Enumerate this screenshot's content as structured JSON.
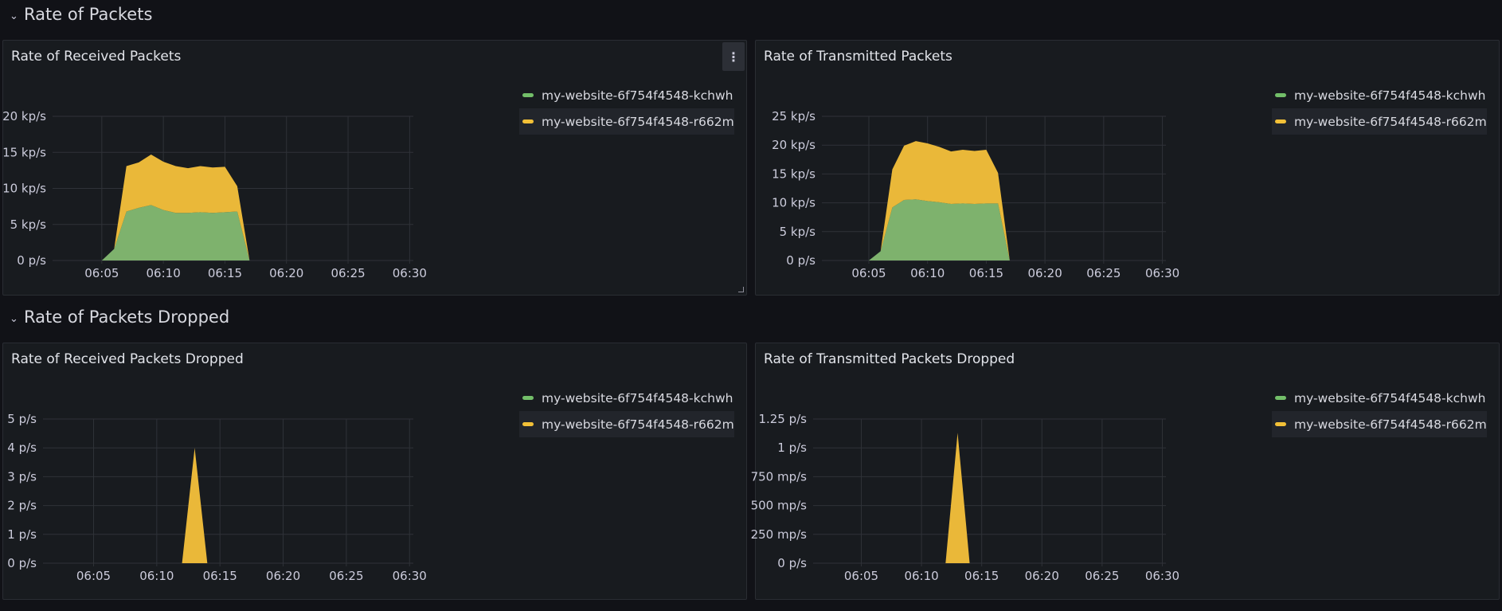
{
  "rows": [
    {
      "title": "Rate of Packets"
    },
    {
      "title": "Rate of Packets Dropped"
    }
  ],
  "colors": {
    "green": "#7eb26d",
    "yellow": "#eab839",
    "grid": "#2f3238"
  },
  "legend": [
    {
      "label": "my-website-6f754f4548-kchwh",
      "color": "#73bf69"
    },
    {
      "label": "my-website-6f754f4548-r662m",
      "color": "#f2c037"
    }
  ],
  "menu_icon": "kebab-vertical-icon",
  "panels": [
    {
      "title": "Rate of Received Packets",
      "chart_data": {
        "type": "area",
        "stacked": true,
        "x_ticks": [
          "06:05",
          "06:10",
          "06:15",
          "06:20",
          "06:25",
          "06:30"
        ],
        "x_tick_minutes": [
          5,
          10,
          15,
          20,
          25,
          30
        ],
        "xlim": [
          1,
          30.3
        ],
        "y_ticks": [
          "0 p/s",
          "5 kp/s",
          "10 kp/s",
          "15 kp/s",
          "20 kp/s"
        ],
        "ylim": [
          0,
          20000
        ],
        "x": [
          5,
          6,
          7,
          8,
          9,
          10,
          11,
          12,
          13,
          14,
          15,
          16,
          17
        ],
        "series": [
          {
            "name": "my-website-6f754f4548-kchwh",
            "values": [
              0,
              1600,
              6800,
              7300,
              7700,
              7000,
              6600,
              6600,
              6700,
              6600,
              6700,
              6800,
              0
            ]
          },
          {
            "name": "my-website-6f754f4548-r662m",
            "values": [
              0,
              0,
              6300,
              6300,
              7000,
              6700,
              6500,
              6200,
              6400,
              6300,
              6300,
              3500,
              0
            ]
          }
        ],
        "grid": true,
        "legend_position": "right"
      }
    },
    {
      "title": "Rate of Transmitted Packets",
      "chart_data": {
        "type": "area",
        "stacked": true,
        "x_ticks": [
          "06:05",
          "06:10",
          "06:15",
          "06:20",
          "06:25",
          "06:30"
        ],
        "x_tick_minutes": [
          5,
          10,
          15,
          20,
          25,
          30
        ],
        "xlim": [
          1,
          30.3
        ],
        "y_ticks": [
          "0 p/s",
          "5 kp/s",
          "10 kp/s",
          "15 kp/s",
          "20 kp/s",
          "25 kp/s"
        ],
        "ylim": [
          0,
          25000
        ],
        "x": [
          5,
          6,
          7,
          8,
          9,
          10,
          11,
          12,
          13,
          14,
          15,
          16,
          17
        ],
        "series": [
          {
            "name": "my-website-6f754f4548-kchwh",
            "values": [
              0,
              1600,
              9200,
              10500,
              10600,
              10300,
              10100,
              9800,
              9900,
              9800,
              9900,
              9900,
              0
            ]
          },
          {
            "name": "my-website-6f754f4548-r662m",
            "values": [
              0,
              0,
              6600,
              9400,
              10100,
              10000,
              9600,
              9100,
              9300,
              9200,
              9300,
              5300,
              0
            ]
          }
        ],
        "grid": true,
        "legend_position": "right"
      }
    },
    {
      "title": "Rate of Received Packets Dropped",
      "chart_data": {
        "type": "area",
        "stacked": true,
        "x_ticks": [
          "06:05",
          "06:10",
          "06:15",
          "06:20",
          "06:25",
          "06:30"
        ],
        "x_tick_minutes": [
          5,
          10,
          15,
          20,
          25,
          30
        ],
        "xlim": [
          1,
          30.3
        ],
        "y_ticks": [
          "0 p/s",
          "1 p/s",
          "2 p/s",
          "3 p/s",
          "4 p/s",
          "5 p/s"
        ],
        "ylim": [
          0,
          5
        ],
        "x": [
          12,
          13,
          14
        ],
        "series": [
          {
            "name": "my-website-6f754f4548-kchwh",
            "values": [
              0,
              0,
              0
            ]
          },
          {
            "name": "my-website-6f754f4548-r662m",
            "values": [
              0,
              4,
              0
            ]
          }
        ],
        "grid": true,
        "legend_position": "right"
      }
    },
    {
      "title": "Rate of Transmitted Packets Dropped",
      "chart_data": {
        "type": "area",
        "stacked": true,
        "x_ticks": [
          "06:05",
          "06:10",
          "06:15",
          "06:20",
          "06:25",
          "06:30"
        ],
        "x_tick_minutes": [
          5,
          10,
          15,
          20,
          25,
          30
        ],
        "xlim": [
          1,
          30.3
        ],
        "y_ticks": [
          "0 p/s",
          "250 mp/s",
          "500 mp/s",
          "750 mp/s",
          "1 p/s",
          "1.25 p/s"
        ],
        "ylim": [
          0,
          1.25
        ],
        "x": [
          12,
          13,
          14
        ],
        "series": [
          {
            "name": "my-website-6f754f4548-kchwh",
            "values": [
              0,
              0,
              0
            ]
          },
          {
            "name": "my-website-6f754f4548-r662m",
            "values": [
              0,
              1.13,
              0
            ]
          }
        ],
        "grid": true,
        "legend_position": "right"
      }
    }
  ]
}
